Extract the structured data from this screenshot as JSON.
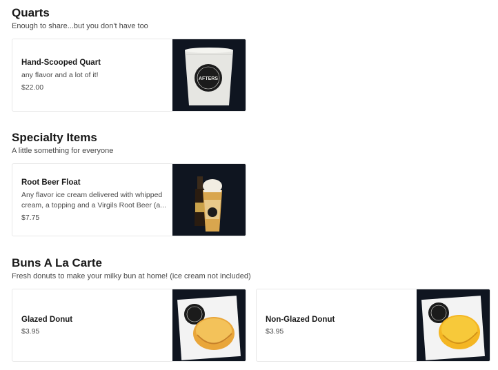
{
  "sections": [
    {
      "title": "Quarts",
      "subtitle": "Enough to share...but you don't have too",
      "items": [
        {
          "name": "Hand-Scooped Quart",
          "description": "any flavor and a lot of it!",
          "price": "$22.00",
          "image": "ice-cream-quart-image"
        }
      ]
    },
    {
      "title": "Specialty Items",
      "subtitle": "A little something for everyone",
      "items": [
        {
          "name": "Root Beer Float",
          "description": "Any flavor ice cream delivered with whipped cream, a topping and a Virgils Root Beer (a...",
          "price": "$7.75",
          "image": "root-beer-float-image"
        }
      ]
    },
    {
      "title": "Buns A La Carte",
      "subtitle": "Fresh donuts to make your milky bun at home! (ice cream not included)",
      "items": [
        {
          "name": "Glazed Donut",
          "description": "",
          "price": "$3.95",
          "image": "glazed-donut-image"
        },
        {
          "name": "Non-Glazed Donut",
          "description": "",
          "price": "$3.95",
          "image": "non-glazed-donut-image"
        }
      ]
    }
  ],
  "brand": {
    "logo_text": "AFTERS",
    "logo_arc_top": "HANDCRAFTED",
    "logo_arc_bottom": "ICE CREAM"
  },
  "colors": {
    "photo_background": "#0f1520",
    "border": "#e7e7e7",
    "text_primary": "#191919",
    "text_secondary": "#494949"
  }
}
